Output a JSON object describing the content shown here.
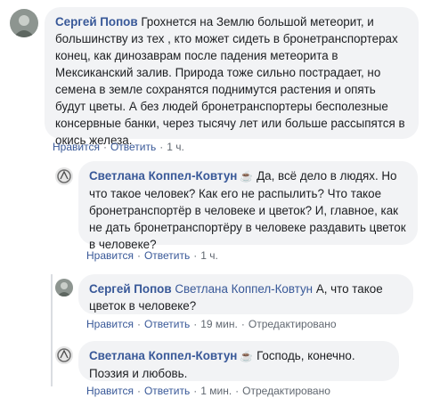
{
  "comments": [
    {
      "author": "Сергей Попов",
      "text": "Грохнется на Землю большой метеорит, и большинству из тех , кто может сидеть в бронетранспортерах конец, как динозаврам после падения метеорита в Мексиканский залив. Природа тоже сильно пострадает, но семена в земле сохранятся поднимутся растения и опять будут цветы. А без людей бронетранспортеры бесполезные консервные банки, через тысячу лет или больше рассыпятся в окись железа.",
      "like": "Нравится",
      "reply": "Ответить",
      "time": "1 ч."
    },
    {
      "author": "Светлана Коппел-Ковтун",
      "badge": "☕",
      "text": "Да, всё дело в людях. Но что такое человек? Как его не распылить? Что такое бронетранспортёр в человеке и цветок? И, главное, как не дать бронетранспортёру в человеке раздавить цветок в человеке?",
      "like": "Нравится",
      "reply": "Ответить",
      "time": "1 ч."
    },
    {
      "author": "Сергей Попов",
      "mention": "Светлана Коппел-Ковтун",
      "text": "А, что такое цветок в человеке?",
      "like": "Нравится",
      "reply": "Ответить",
      "time": "19 мин.",
      "edited": "Отредактировано"
    },
    {
      "author": "Светлана Коппел-Ковтун",
      "badge": "☕",
      "text": "Господь, конечно. Поэзия и любовь.",
      "like": "Нравится",
      "reply": "Ответить",
      "time": "1 мин.",
      "edited": "Отредактировано"
    }
  ]
}
